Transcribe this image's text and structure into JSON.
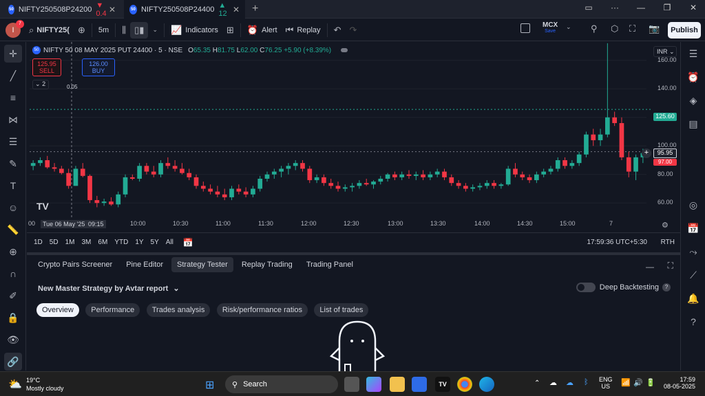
{
  "browser": {
    "tabs": [
      {
        "favicon": "50",
        "title": "NIFTY250508P24200",
        "price": "0.4",
        "direction": "down"
      },
      {
        "favicon": "50",
        "title": "NIFTY250508P24400",
        "price": "12",
        "direction": "up"
      }
    ],
    "new_tab": "+"
  },
  "toolbar": {
    "avatar_letter": "I",
    "notif_count": "7",
    "symbol": "NIFTY25(",
    "interval": "5m",
    "indicators_label": "Indicators",
    "alert_label": "Alert",
    "replay_label": "Replay",
    "exchange": "MCX",
    "exchange_sub": "Save",
    "publish_label": "Publish"
  },
  "chart": {
    "symbol_badge": "50",
    "title": "NIFTY 50 08 MAY 2025 PUT 24400 · 5 · NSE",
    "open_label": "O",
    "open": "65.35",
    "high_label": "H",
    "high": "81.75",
    "low_label": "L",
    "low": "62.00",
    "close_label": "C",
    "close": "76.25",
    "change": "+5.90 (+8.39%)",
    "sell_price": "125.95",
    "sell_label": "SELL",
    "spread": "0.05",
    "buy_price": "126.00",
    "buy_label": "BUY",
    "collapse_count": "2",
    "currency": "INR",
    "price_ticks": [
      "160.00",
      "140.00",
      "120.00",
      "100.00",
      "80.00",
      "60.00"
    ],
    "badge_last": "125.60",
    "badge_cursor": "95.95",
    "badge_red": "97.00",
    "time_ticks": [
      "00",
      "Tue 06 May '25",
      "09:15",
      "10:00",
      "10:30",
      "11:00",
      "11:30",
      "12:00",
      "12:30",
      "13:00",
      "13:30",
      "14:00",
      "14:30",
      "15:00",
      "7"
    ],
    "colors": {
      "up": "#22ab94",
      "down": "#f23645",
      "bg": "#131722"
    }
  },
  "chart_data": {
    "type": "candlestick",
    "series": [
      {
        "ohlc": [
          [
            86,
            90,
            83,
            88
          ],
          [
            88,
            92,
            86,
            90
          ],
          [
            90,
            93,
            84,
            85
          ],
          [
            85,
            88,
            82,
            84
          ],
          [
            84,
            86,
            80,
            81
          ],
          [
            81,
            84,
            70,
            72
          ],
          [
            72,
            86,
            72,
            84
          ],
          [
            84,
            88,
            78,
            79
          ],
          [
            79,
            80,
            60,
            62
          ],
          [
            62,
            65,
            57,
            60
          ],
          [
            60,
            63,
            58,
            61
          ],
          [
            61,
            64,
            58,
            59
          ],
          [
            59,
            68,
            57,
            66
          ],
          [
            66,
            80,
            64,
            78
          ],
          [
            78,
            80,
            76,
            77
          ],
          [
            77,
            88,
            75,
            86
          ],
          [
            86,
            88,
            80,
            82
          ],
          [
            82,
            86,
            78,
            80
          ],
          [
            80,
            90,
            78,
            88
          ],
          [
            88,
            92,
            84,
            86
          ],
          [
            86,
            90,
            82,
            84
          ],
          [
            84,
            88,
            80,
            81
          ],
          [
            81,
            84,
            76,
            78
          ],
          [
            78,
            80,
            70,
            72
          ],
          [
            72,
            75,
            68,
            70
          ],
          [
            70,
            73,
            66,
            68
          ],
          [
            68,
            72,
            64,
            66
          ],
          [
            66,
            70,
            62,
            64
          ],
          [
            64,
            72,
            62,
            70
          ],
          [
            70,
            73,
            66,
            68
          ],
          [
            68,
            71,
            64,
            66
          ],
          [
            66,
            72,
            64,
            70
          ],
          [
            70,
            79,
            68,
            77
          ],
          [
            77,
            82,
            75,
            80
          ],
          [
            80,
            84,
            77,
            82
          ],
          [
            82,
            86,
            78,
            84
          ],
          [
            84,
            88,
            80,
            86
          ],
          [
            86,
            90,
            83,
            88
          ],
          [
            88,
            90,
            82,
            84
          ],
          [
            84,
            86,
            74,
            76
          ],
          [
            76,
            80,
            74,
            78
          ],
          [
            78,
            80,
            72,
            74
          ],
          [
            74,
            77,
            70,
            72
          ],
          [
            72,
            75,
            68,
            70
          ],
          [
            70,
            73,
            68,
            71
          ],
          [
            71,
            74,
            68,
            72
          ],
          [
            72,
            76,
            70,
            74
          ],
          [
            74,
            77,
            72,
            73
          ],
          [
            73,
            76,
            70,
            75
          ],
          [
            75,
            79,
            73,
            77
          ],
          [
            77,
            81,
            75,
            80
          ],
          [
            80,
            82,
            76,
            78
          ],
          [
            78,
            82,
            76,
            80
          ],
          [
            80,
            83,
            77,
            79
          ],
          [
            79,
            82,
            76,
            80
          ],
          [
            80,
            83,
            76,
            78
          ],
          [
            78,
            82,
            76,
            80
          ],
          [
            80,
            84,
            78,
            82
          ],
          [
            82,
            84,
            76,
            78
          ],
          [
            78,
            80,
            72,
            74
          ],
          [
            74,
            76,
            70,
            72
          ],
          [
            72,
            74,
            68,
            70
          ],
          [
            70,
            73,
            68,
            71
          ],
          [
            71,
            74,
            69,
            72
          ],
          [
            72,
            76,
            70,
            74
          ],
          [
            74,
            76,
            70,
            72
          ],
          [
            72,
            74,
            70,
            73
          ],
          [
            73,
            86,
            72,
            84
          ],
          [
            84,
            88,
            78,
            80
          ],
          [
            80,
            82,
            76,
            78
          ],
          [
            78,
            80,
            74,
            76
          ],
          [
            76,
            82,
            74,
            80
          ],
          [
            80,
            84,
            78,
            82
          ],
          [
            82,
            86,
            80,
            84
          ],
          [
            84,
            92,
            82,
            90
          ],
          [
            90,
            92,
            84,
            86
          ],
          [
            86,
            90,
            84,
            88
          ],
          [
            88,
            96,
            86,
            94
          ],
          [
            94,
            110,
            92,
            108
          ],
          [
            108,
            112,
            100,
            104
          ],
          [
            104,
            112,
            100,
            108
          ],
          [
            108,
            172,
            106,
            120
          ],
          [
            120,
            124,
            114,
            116
          ],
          [
            116,
            120,
            90,
            92
          ],
          [
            92,
            96,
            78,
            82
          ],
          [
            82,
            94,
            76,
            92
          ],
          [
            92,
            98,
            88,
            95
          ]
        ]
      }
    ],
    "ylim": [
      50,
      170
    ]
  },
  "range_bar": {
    "ranges": [
      "1D",
      "5D",
      "1M",
      "3M",
      "6M",
      "YTD",
      "1Y",
      "5Y",
      "All"
    ],
    "clock": "17:59:36 UTC+5:30",
    "session": "RTH"
  },
  "panel": {
    "tabs": [
      "Crypto Pairs Screener",
      "Pine Editor",
      "Strategy Tester",
      "Replay Trading",
      "Trading Panel"
    ],
    "active_tab": 2,
    "strategy_name": "New Master Strategy by Avtar report",
    "deep_backtesting_label": "Deep Backtesting",
    "subtabs": [
      "Overview",
      "Performance",
      "Trades analysis",
      "Risk/performance ratios",
      "List of trades"
    ],
    "active_subtab": 0
  },
  "taskbar": {
    "weather_temp": "19°C",
    "weather_desc": "Mostly cloudy",
    "search_placeholder": "Search",
    "lang_line1": "ENG",
    "lang_line2": "US",
    "time": "17:59",
    "date": "08-05-2025"
  }
}
